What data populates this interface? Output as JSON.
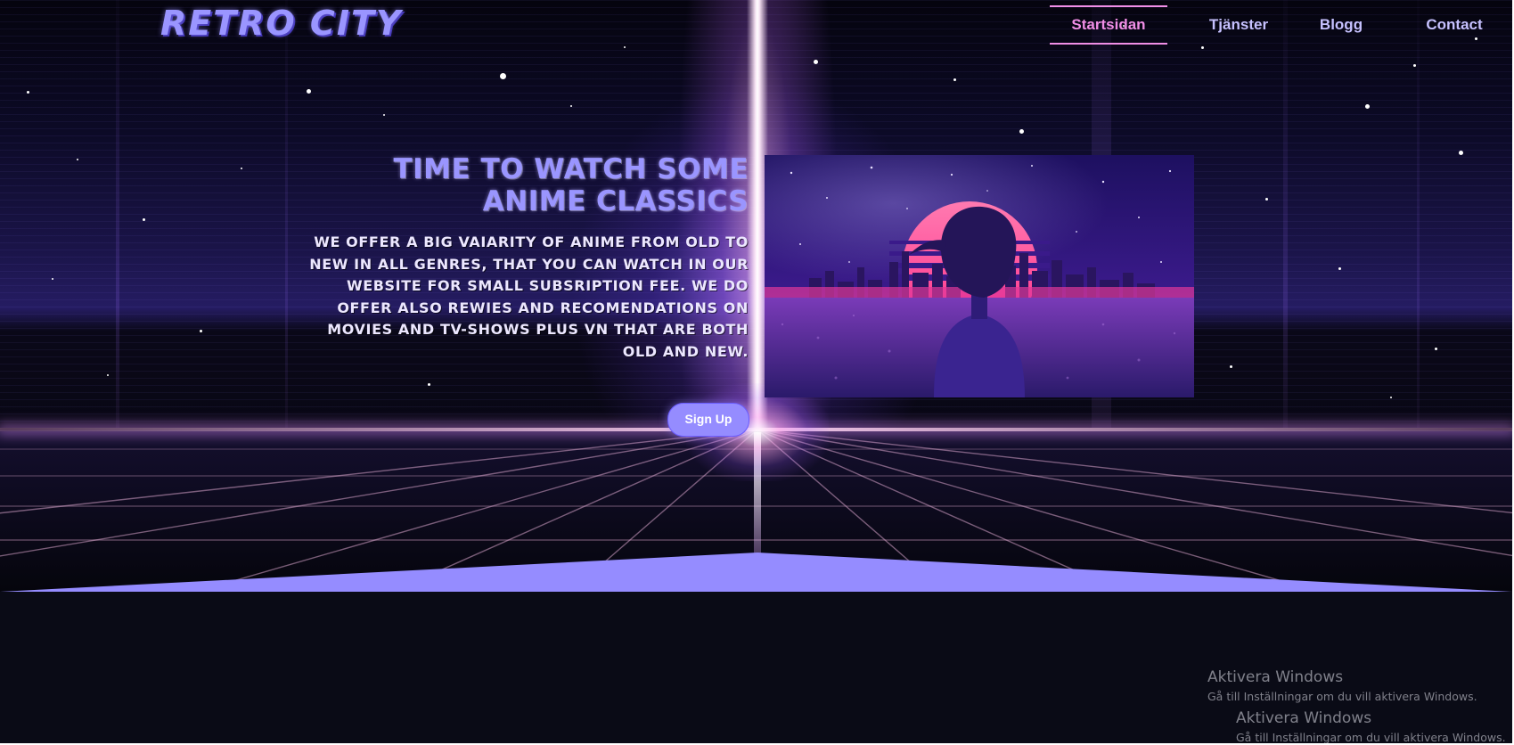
{
  "site": {
    "logo": "RETRO CITY"
  },
  "nav": {
    "items": [
      {
        "label": "Startsidan",
        "active": true
      },
      {
        "label": "Tjänster",
        "active": false
      },
      {
        "label": "Blogg",
        "active": false
      },
      {
        "label": "Contact",
        "active": false
      }
    ]
  },
  "hero": {
    "title": "Time to watch some anime classics",
    "text": "We offer a big vaiarity of anime from old to new in all genres, that you can watch in our website for small subsription fee. We do offer also rewies and recomendations on movies and tv-shows plus vn that are both old and new.",
    "cta_label": "Sign Up",
    "image_icon": "anime-girl-synthwave-sunset-illustration"
  },
  "watermark": {
    "title": "Aktivera Windows",
    "subtitle": "Gå till Inställningar om du vill aktivera Windows."
  },
  "colors": {
    "accent": "#958cff",
    "nav_active": "#f08ee6",
    "footer_bg": "#0a0b16"
  }
}
